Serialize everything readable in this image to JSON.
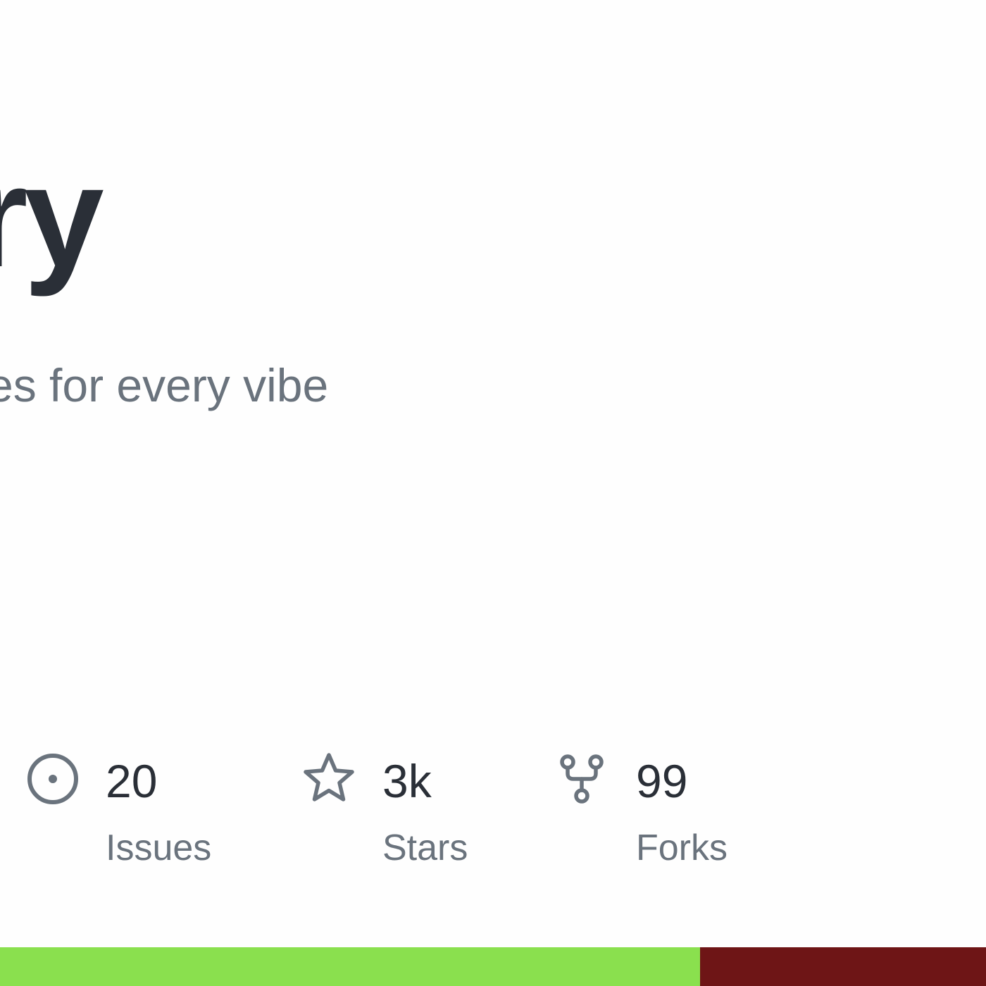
{
  "repo": {
    "title_fragment": "ry",
    "description_fragment": "es for every vibe"
  },
  "stats": {
    "issues": {
      "value": "20",
      "label": "Issues",
      "icon": "issue-opened-icon"
    },
    "stars": {
      "value": "3k",
      "label": "Stars",
      "icon": "star-icon"
    },
    "forks": {
      "value": "99",
      "label": "Forks",
      "icon": "repo-forked-icon"
    }
  },
  "colors": {
    "text_primary": "#2a2f37",
    "text_secondary": "#6a737d",
    "icon": "#6a737d",
    "lang_green": "#8ae04e",
    "lang_maroon": "#6e1516"
  },
  "language_bar": [
    {
      "color": "#8ae04e",
      "fraction": 0.71
    },
    {
      "color": "#6e1516",
      "fraction": 0.29
    }
  ]
}
